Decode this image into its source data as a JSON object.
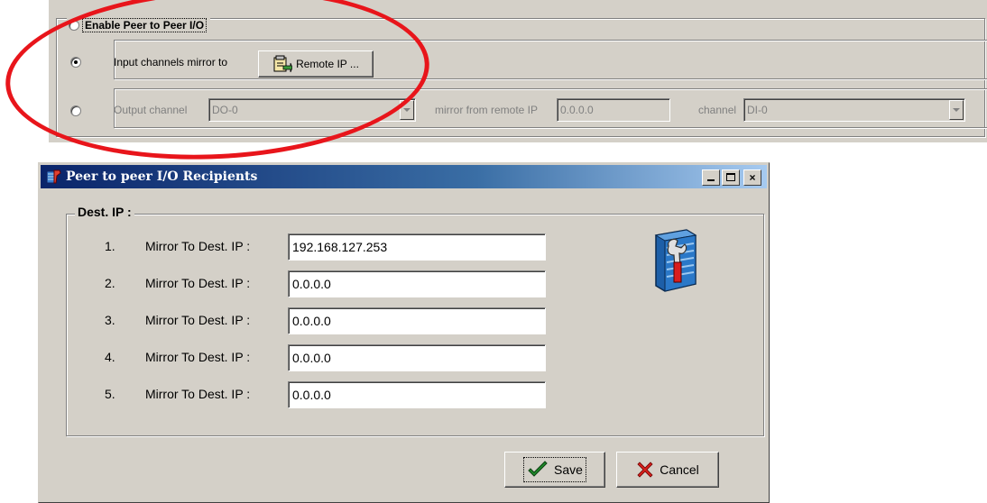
{
  "peer_panel": {
    "enable_label": "Enable Peer to Peer I/O",
    "input_row": {
      "label": "Input channels mirror to",
      "remote_ip_button": "Remote IP ..."
    },
    "output_row": {
      "output_channel_label": "Output channel",
      "output_channel_value": "DO-0",
      "mirror_from_label": "mirror from remote IP",
      "mirror_from_value": "0.0.0.0",
      "channel_label": "channel",
      "channel_value": "DI-0"
    }
  },
  "dialog": {
    "title": "Peer to peer I/O Recipients",
    "group_label": "Dest. IP :",
    "rows": [
      {
        "num": "1.",
        "label": "Mirror To Dest. IP :",
        "value": "192.168.127.253"
      },
      {
        "num": "2.",
        "label": "Mirror To Dest. IP :",
        "value": "0.0.0.0"
      },
      {
        "num": "3.",
        "label": "Mirror To Dest. IP :",
        "value": "0.0.0.0"
      },
      {
        "num": "4.",
        "label": "Mirror To Dest. IP :",
        "value": "0.0.0.0"
      },
      {
        "num": "5.",
        "label": "Mirror To Dest. IP :",
        "value": "0.0.0.0"
      }
    ],
    "save_label": "Save",
    "cancel_label": "Cancel",
    "close_glyph": "×"
  },
  "colors": {
    "annotation_ellipse": "#e8151b",
    "titlebar": "#0a246a",
    "window_face": "#d4d0c8"
  },
  "icons": [
    "remote-ip-icon",
    "app-icon",
    "tools-icon",
    "checkmark-icon",
    "x-mark-icon"
  ]
}
